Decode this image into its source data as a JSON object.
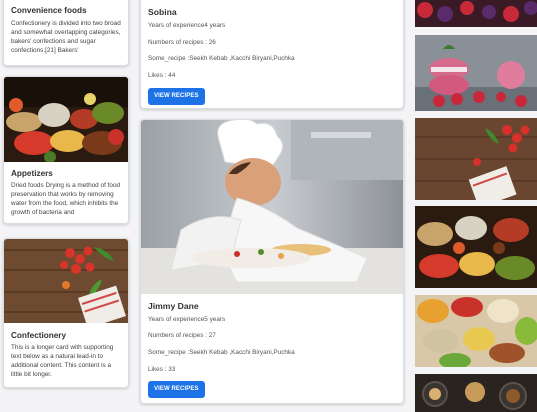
{
  "category_cards": [
    {
      "title": "Convenience foods",
      "text": "Confectionery is divided into two broad and somewhat overlapping categories, bakers' confections and sugar confections.[21] Bakers'"
    },
    {
      "title": "Appetizers",
      "text": "Dried foods Drying is a method of food preservation that works by removing water from the food, which inhibits the growth of bacteria and"
    },
    {
      "title": "Confectionery",
      "text": "This is a longer card with supporting text below as a natural lead-in to additional content. This content is a little bit longer."
    }
  ],
  "chef_cards": [
    {
      "name": "Sobina",
      "experience": "Years of experience4 years",
      "recipes": "Numbers of recipes : 26",
      "some_recipe": "Some_recipe :Seekh Kebab ,Kacchi Biryani,Puchka",
      "likes": "Likes : 44",
      "button": "VIEW RECIPES"
    },
    {
      "name": "Jimmy Dane",
      "experience": "Years of experience5 years",
      "recipes": "Numbers of recipes : 27",
      "some_recipe": "Some_recipe :Seekh Kebab ,Kacchi Biryani,Puchka",
      "likes": "Likes : 33",
      "button": "VIEW RECIPES"
    }
  ],
  "colors": {
    "button_blue": "#1d72e8",
    "page_background": "#f4f4f6"
  },
  "gallery_images": [
    "berries-image",
    "macaron-image",
    "tomatoes-wood-image",
    "food-spread-image",
    "platter-image",
    "dark-table-image"
  ]
}
